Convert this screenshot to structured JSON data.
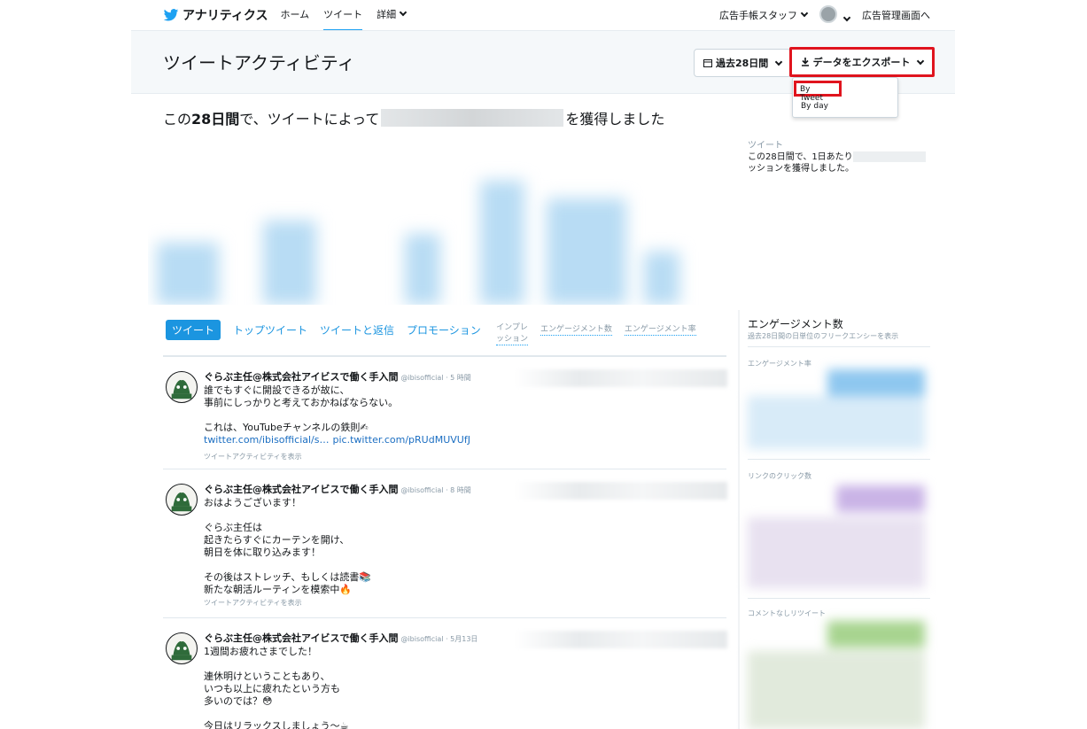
{
  "nav": {
    "brand": "アナリティクス",
    "links": [
      {
        "label": "ホーム"
      },
      {
        "label": "ツイート"
      },
      {
        "label": "詳細"
      }
    ],
    "account": "広告手帳スタッフ",
    "ads_manager": "広告管理画面へ"
  },
  "header": {
    "title": "ツイートアクティビティ",
    "period_label": "過去28日間",
    "export_label": "データをエクスポート",
    "export_menu": [
      "By Tweet",
      "By day"
    ]
  },
  "summary": {
    "prefix": "この",
    "bold": "28日間",
    "middle": "で、ツイートによって",
    "suffix": "を獲得しました"
  },
  "side_summary": {
    "label": "ツイート",
    "line1": "この28日間で、1日あたり",
    "line2": "ッションを獲得しました。"
  },
  "tabs": [
    "ツイート",
    "トップツイート",
    "ツイートと返信",
    "プロモーション"
  ],
  "columns": {
    "impressions_line1": "インプレ",
    "impressions_line2": "ッション",
    "engagements": "エンゲージメント数",
    "engagement_rate": "エンゲージメント率"
  },
  "tweets": [
    {
      "name": "ぐらぶ主任@株式会社アイビスで働く手入間",
      "handle": "@ibisofficial · 5 時間",
      "text": "誰でもすぐに開設できるが故に、\n事前にしっかりと考えておかねばならない。\n\nこれは、YouTubeチャンネルの鉄則✍",
      "link1": "twitter.com/ibisofficial/s…",
      "link2": "pic.twitter.com/pRUdMUVUfJ",
      "activity": "ツイートアクティビティを表示"
    },
    {
      "name": "ぐらぶ主任@株式会社アイビスで働く手入間",
      "handle": "@ibisofficial · 8 時間",
      "text": "おはようございます！\n\nぐらぶ主任は\n起きたらすぐにカーテンを開け、\n朝日を体に取り込みます！\n\nその後はストレッチ、もしくは読書📚\n新たな朝活ルーティンを模索中🔥",
      "activity": "ツイートアクティビティを表示"
    },
    {
      "name": "ぐらぶ主任@株式会社アイビスで働く手入間",
      "handle": "@ibisofficial · 5月13日",
      "text": "1週間お疲れさまでした！\n\n連休明けということもあり、\nいつも以上に疲れたという方も\n多いのでは？😳\n\n今日はリラックスしましょう～☕"
    }
  ],
  "right_panel": {
    "title": "エンゲージメント数",
    "subtitle": "過去28日間の日単位のフリークエンシーを表示",
    "sections": [
      "エンゲージメント率",
      "リンクのクリック数",
      "コメントなしリツイート"
    ],
    "colors": [
      "#8ec7ef",
      "#c9b3e6",
      "#a7d48f"
    ]
  },
  "accent_color": "#1da1f2",
  "highlight_color": "#e0141e"
}
